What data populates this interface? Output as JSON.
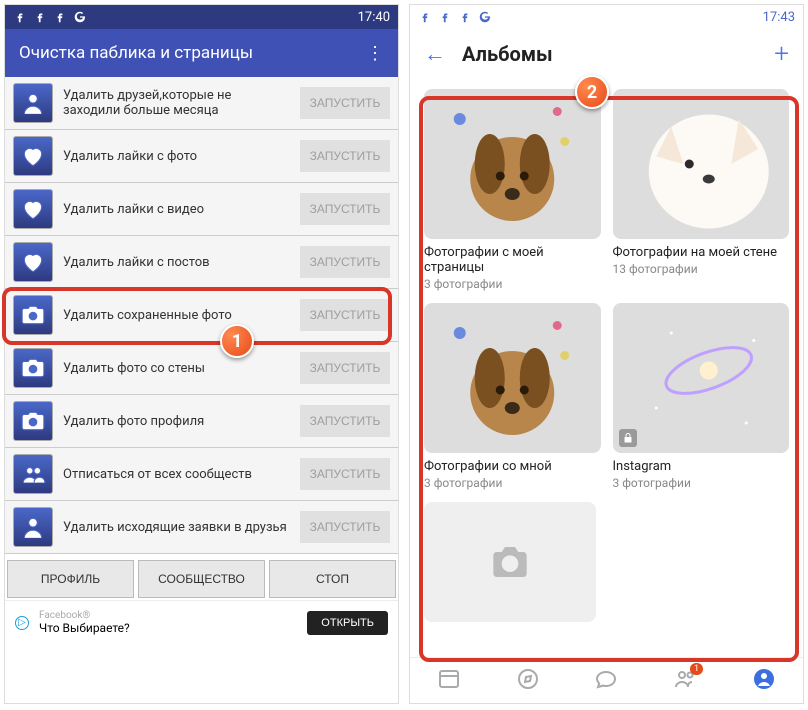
{
  "left": {
    "status": {
      "time": "17:40"
    },
    "app_title": "Очистка паблика и страницы",
    "run_label": "ЗАПУСТИТЬ",
    "rows": [
      {
        "label": "Удалить друзей,которые не заходили больше месяца",
        "icon": "person"
      },
      {
        "label": "Удалить лайки с фото",
        "icon": "heart"
      },
      {
        "label": "Удалить лайки с видео",
        "icon": "heart"
      },
      {
        "label": "Удалить лайки с постов",
        "icon": "heart"
      },
      {
        "label": "Удалить сохраненные фото",
        "icon": "camera",
        "highlight": true
      },
      {
        "label": "Удалить фото со стены",
        "icon": "camera"
      },
      {
        "label": "Удалить фото профиля",
        "icon": "camera"
      },
      {
        "label": "Отписаться от всех сообществ",
        "icon": "people"
      },
      {
        "label": "Удалить исходящие заявки в друзья",
        "icon": "person"
      }
    ],
    "bottom": {
      "profile": "ПРОФИЛЬ",
      "community": "СООБЩЕСТВО",
      "stop": "СТОП"
    },
    "ad": {
      "brand": "Facebook®",
      "text": "Что Выбираете?",
      "open": "ОТКРЫТЬ"
    }
  },
  "right": {
    "status": {
      "time": "17:43"
    },
    "title": "Альбомы",
    "albums": [
      {
        "name": "Фотографии с моей страницы",
        "count": "3 фотографии",
        "thumb": "dog"
      },
      {
        "name": "Фотографии на моей стене",
        "count": "13 фотографии",
        "thumb": "fox"
      },
      {
        "name": "Фотографии со мной",
        "count": "3 фотографии",
        "thumb": "dog"
      },
      {
        "name": "Instagram",
        "count": "3 фотографии",
        "thumb": "galaxy",
        "locked": true
      }
    ],
    "nav_badge": "1"
  },
  "callouts": {
    "one": "1",
    "two": "2"
  }
}
